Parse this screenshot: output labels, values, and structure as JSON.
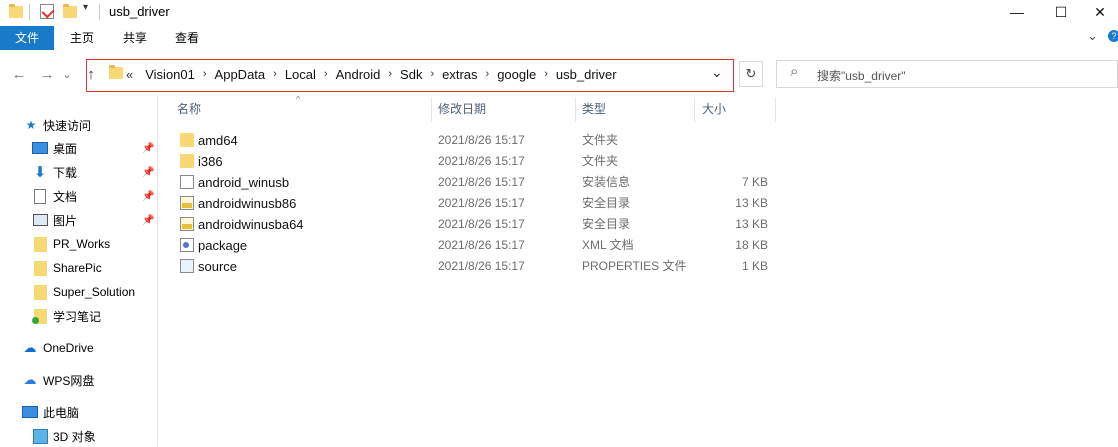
{
  "window": {
    "title": "usb_driver",
    "minimize_glyph": "—",
    "maximize_glyph": "☐",
    "close_glyph": "✕",
    "chevron_glyph": "⌄",
    "help_glyph": "?"
  },
  "quick_access_toolbar": {
    "dropdown_glyph": "▾"
  },
  "ribbon": {
    "tabs": [
      {
        "label": "文件",
        "active": true
      },
      {
        "label": "主页"
      },
      {
        "label": "共享"
      },
      {
        "label": "查看"
      }
    ]
  },
  "nav": {
    "back_glyph": "←",
    "forward_glyph": "→",
    "recent_glyph": "⌄",
    "up_glyph": "↑",
    "refresh_glyph": "↻",
    "address": {
      "overflow": "«",
      "crumbs": [
        "Vision01",
        "AppData",
        "Local",
        "Android",
        "Sdk",
        "extras",
        "google",
        "usb_driver"
      ],
      "separator": "›",
      "dropdown_glyph": "⌄"
    },
    "search": {
      "icon_glyph": "⌕",
      "placeholder": "搜索\"usb_driver\""
    }
  },
  "sidebar": {
    "pin_glyph": "📌",
    "quick_access": "快速访问",
    "pinned": [
      {
        "label": "桌面"
      },
      {
        "label": "下载"
      },
      {
        "label": "文档"
      },
      {
        "label": "图片"
      }
    ],
    "folders": [
      {
        "label": "PR_Works"
      },
      {
        "label": "SharePic"
      },
      {
        "label": "Super_Solution"
      },
      {
        "label": "学习笔记"
      }
    ],
    "onedrive": "OneDrive",
    "wps": "WPS网盘",
    "this_pc": "此电脑",
    "objects3d": "3D 对象"
  },
  "columns": {
    "sort_glyph": "^",
    "name": "名称",
    "date": "修改日期",
    "type": "类型",
    "size": "大小"
  },
  "files": [
    {
      "name": "amd64",
      "date": "2021/8/26 15:17",
      "type": "文件夹",
      "size": "",
      "icon": "folder-icon"
    },
    {
      "name": "i386",
      "date": "2021/8/26 15:17",
      "type": "文件夹",
      "size": "",
      "icon": "folder-icon"
    },
    {
      "name": "android_winusb",
      "date": "2021/8/26 15:17",
      "type": "安装信息",
      "size": "7 KB",
      "icon": "setup-info-icon"
    },
    {
      "name": "androidwinusb86",
      "date": "2021/8/26 15:17",
      "type": "安全目录",
      "size": "13 KB",
      "icon": "security-catalog-icon"
    },
    {
      "name": "androidwinusba64",
      "date": "2021/8/26 15:17",
      "type": "安全目录",
      "size": "13 KB",
      "icon": "security-catalog-icon"
    },
    {
      "name": "package",
      "date": "2021/8/26 15:17",
      "type": "XML 文档",
      "size": "18 KB",
      "icon": "xml-document-icon"
    },
    {
      "name": "source",
      "date": "2021/8/26 15:17",
      "type": "PROPERTIES 文件",
      "size": "1 KB",
      "icon": "properties-file-icon"
    }
  ],
  "colors": {
    "accent": "#1979ca",
    "folder": "#f8d775",
    "highlight_border": "#dd3333"
  }
}
